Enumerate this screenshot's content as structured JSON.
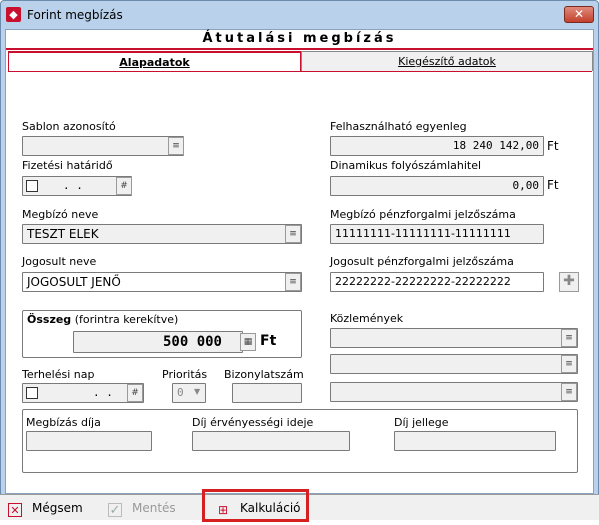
{
  "window": {
    "title": "Forint megbízás",
    "close_label": "✕"
  },
  "form": {
    "header": "Átutalási megbízás"
  },
  "tabs": [
    {
      "label": "Alapadatok",
      "active": true
    },
    {
      "label": "Kiegészítő adatok",
      "active": false
    }
  ],
  "fields": {
    "sablon": {
      "label": "Sablon azonosító",
      "value": ""
    },
    "felhasznalhato": {
      "label": "Felhasználható egyenleg",
      "value": "18 240 142,00",
      "unit": "Ft"
    },
    "fizetesi_hatarido": {
      "label": "Fizetési határidő",
      "value": ". .",
      "btn": "#"
    },
    "dinamikus": {
      "label": "Dinamikus folyószámlahitel",
      "value": "0,00",
      "unit": "Ft"
    },
    "megbizo_neve": {
      "label": "Megbízó neve",
      "value": "TESZT ELEK"
    },
    "megbizo_szamla": {
      "label": "Megbízó pénzforgalmi jelzőszáma",
      "value": "11111111-11111111-11111111"
    },
    "jogosult_neve": {
      "label": "Jogosult neve",
      "value": "JOGOSULT JENŐ"
    },
    "jogosult_szamla": {
      "label": "Jogosult pénzforgalmi jelzőszáma",
      "value": "22222222-22222222-22222222"
    },
    "osszeg": {
      "label": "Összeg",
      "sublabel": "(forintra kerekítve)",
      "value": "500 000",
      "unit": "Ft"
    },
    "kozlemenyek": {
      "label": "Közlemények"
    },
    "terhelesi_nap": {
      "label": "Terhelési nap",
      "value": ". .",
      "btn": "#"
    },
    "prioritas": {
      "label": "Prioritás",
      "value": "0"
    },
    "bizonylatszam": {
      "label": "Bizonylatszám",
      "value": ""
    },
    "megbizas_dija": {
      "label": "Megbízás díja",
      "value": ""
    },
    "dij_ervenyessegi": {
      "label": "Díj érvényességi ideje",
      "value": ""
    },
    "dij_jellege": {
      "label": "Díj jellege",
      "value": ""
    }
  },
  "buttons": {
    "cancel": "Mégsem",
    "save": "Mentés",
    "calc": "Kalkuláció"
  },
  "colors": {
    "accent": "#c8102e",
    "highlight": "#d62020",
    "frame": "#b9d1ea"
  }
}
